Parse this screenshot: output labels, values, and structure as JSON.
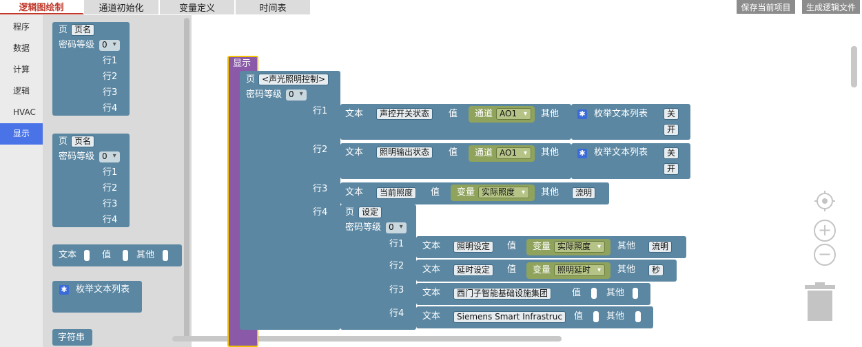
{
  "tabs": [
    "逻辑图绘制",
    "通道初始化",
    "变量定义",
    "时间表"
  ],
  "top_buttons": {
    "save": "保存当前项目",
    "generate": "生成逻辑文件"
  },
  "categories": [
    "程序",
    "数据",
    "计算",
    "逻辑",
    "HVAC",
    "显示"
  ],
  "flyout": {
    "page_label": "页",
    "page_name": "页名",
    "pwd_label": "密码等级",
    "pwd_value": "0",
    "rows": [
      "行1",
      "行2",
      "行3",
      "行4"
    ],
    "text_label": "文本",
    "value_label": "值",
    "other_label": "其他",
    "enum_label": "枚举文本列表",
    "string_label": "字符串"
  },
  "display": {
    "label": "显示",
    "page_label": "页",
    "page_name": "<声光照明控制>",
    "pwd_label": "密码等级",
    "pwd_value": "0",
    "rows": [
      "行1",
      "行2",
      "行3",
      "行4"
    ],
    "text_label": "文本",
    "value_label": "值",
    "other_label": "其他",
    "channel_label": "通道",
    "var_label": "变量",
    "enum_label": "枚举文本列表",
    "r1": {
      "text": "声控开关状态",
      "channel": "AO1",
      "opt1": "关",
      "opt2": "开"
    },
    "r2": {
      "text": "照明输出状态",
      "channel": "AO1",
      "opt1": "关",
      "opt2": "开"
    },
    "r3": {
      "text": "当前照度",
      "var": "实际照度",
      "other": "流明"
    },
    "sub": {
      "page_name": "设定",
      "pwd_value": "0",
      "r1": {
        "text": "照明设定",
        "var": "实际照度",
        "other": "流明"
      },
      "r2": {
        "text": "延时设定",
        "var": "照明延时",
        "other": "秒"
      },
      "r3": {
        "text": "西门子智能基础设施集团"
      },
      "r4": {
        "text": "Siemens Smart Infrastruc"
      }
    }
  }
}
